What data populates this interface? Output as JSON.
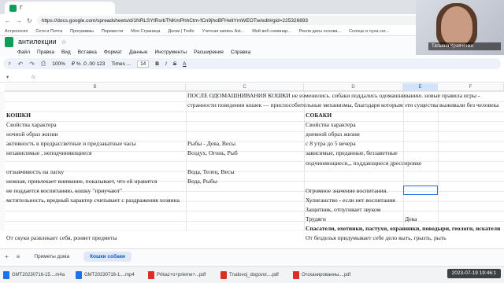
{
  "browser": {
    "tab_title": "Г",
    "url": "https://docs.google.com/spreadsheets/d/1NRLSYtRsrbTNKmPhhCtm-fCn9jhoBFHeltYmWEOTw/edit#gid=225326893",
    "bookmarks": [
      "Астрология",
      "Сети и Почта",
      "Программы",
      "Перевести",
      "Моя Страница",
      "Доски | Trello",
      "Учетная запись Ast...",
      "Мой веб-семинар...",
      "Рекли даты основа...",
      "Солнце и луна сег..."
    ]
  },
  "doc": {
    "title": "антилекции",
    "menu": [
      "Файл",
      "Правка",
      "Вид",
      "Вставка",
      "Формат",
      "Данные",
      "Инструменты",
      "Расширения",
      "Справка"
    ],
    "zoom": "100%",
    "font": "Times ...",
    "font_size": "14",
    "fx_label": "fx",
    "columns": [
      "B",
      "C",
      "D",
      "E",
      "F"
    ]
  },
  "cells": {
    "r1": "ПОСЛЕ ОДОМАШНИВАНИЯ КОШКИ не изменились. сибаки поддались  одомашниванию. новые правила игры -",
    "r2": "странности поведения кошек — приспособительные механизмы, благодаря которым эти существа выживали без человека",
    "koshki": "КОШКИ",
    "sobaki": "СОБАКИ",
    "b_svoistva": "Свойства характера",
    "d_svoistva": "Свойства характера",
    "b_noch": "ночной образ жизни",
    "d_den": "дневной образ жизни",
    "b_aktiv": "активность в предрассветные и предзакатные часы",
    "c_ryby": "Рыбы - Дева, Весы",
    "d_utro": "с 8 утра до 5 вечера",
    "b_nezav": "независимые , неподчиняющиеся",
    "c_vozd": "Воздух, Огонь, Рыб",
    "d_zavis": "зависимые, преданные, беззаветные",
    "d_podch": "подчиняющиеся,,, поддающиеся дрессировке",
    "b_otzyv": "отзывчивость на ласку",
    "c_voda": "Вода, Телец, Весы",
    "b_nezhn": "нежная, привлекает внимание, показывает, что ей нравится",
    "c_voda2": "Вода, Рыбы",
    "b_ne_pod": "не поддается воспитанию, кошку \"приучают\"",
    "d_ogrom": "Огромное значение воспитания.",
    "b_mstit": "мстительность, вредный характер считывает с раздражения хозяина",
    "d_hulig": "Хулиганство - если нет воспитания",
    "d_zasch": "Защитник, отпугивает звуком",
    "d_trud": "Трудяги",
    "e_deva": "Дева",
    "d_spas": "Спасатели, охотники, пастухи, охранники, поводыри, геологи, искатели",
    "b_skuki": "От скуки развлекает себя, роняет предметы",
    "d_bezd": "От безделья придумывает себе дело выть, грызть, рыть"
  },
  "sheets": [
    "Приметы дома",
    "Кошки собаки"
  ],
  "active_sheet": "Кошки собаки",
  "downloads": [
    "GMT20230716-15....m4a",
    "GMT20230716-1....mp4",
    "Prikaz+o+prieme+...pdf",
    "Trudovoj_dogovor....pdf",
    "Отсканированны....pdf"
  ],
  "clock": "2023-07-19  19:46:1",
  "video_name": "Татьяна Кравченко"
}
